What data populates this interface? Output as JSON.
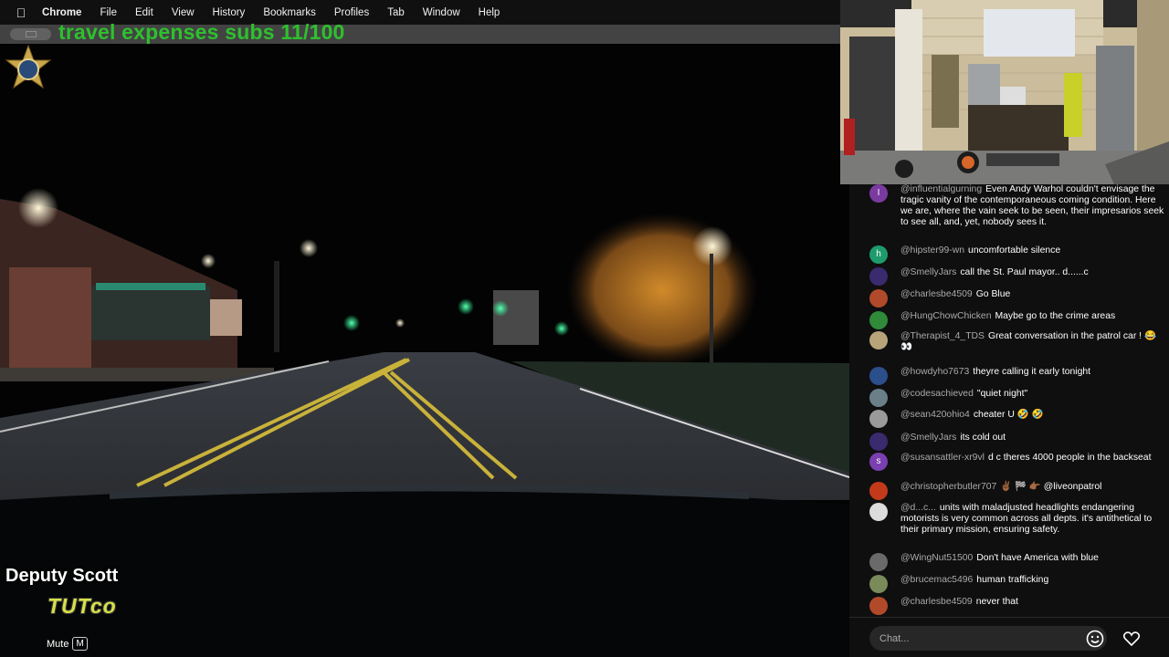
{
  "menubar": {
    "apple_icon": "apple-icon",
    "items": [
      "Chrome",
      "File",
      "Edit",
      "View",
      "History",
      "Bookmarks",
      "Profiles",
      "Tab",
      "Window",
      "Help"
    ]
  },
  "banner": {
    "text": "travel expenses subs 11/100",
    "color": "#2ec02e"
  },
  "video": {
    "deputy_label": "Deputy Scott",
    "brand_text": "TUTco",
    "mute_label": "Mute",
    "mute_key": "M"
  },
  "chat": {
    "messages": [
      {
        "user": "@influentialgurning",
        "text": "Even Andy Warhol couldn't envisage the tragic vanity of the contemporaneous coming condition. Here we are, where the vain seek to be seen, their impresarios seek to see all, and, yet, nobody sees it.",
        "avatar": "I",
        "avatar_color": "#7b3aa0"
      },
      {
        "user": "@hipster99-wn",
        "text": "uncomfortable silence",
        "avatar": "h",
        "avatar_color": "#1e9b6c"
      },
      {
        "user": "@SmellyJars",
        "text": "call the St. Paul mayor.. d......c",
        "avatar": "",
        "avatar_color": "#3a2a6e"
      },
      {
        "user": "@charlesbe4509",
        "text": "Go Blue",
        "avatar": "",
        "avatar_color": "#b04a2a"
      },
      {
        "user": "@HungChowChicken",
        "text": "Maybe go to the crime areas",
        "avatar": "",
        "avatar_color": "#2f8a3a"
      },
      {
        "user": "@Therapist_4_TDS",
        "text": "Great conversation in the patrol car ! 😂 👀",
        "avatar": "",
        "avatar_color": "#b9a37a"
      },
      {
        "user": "@howdyho7673",
        "text": "theyre calling it early tonight",
        "avatar": "",
        "avatar_color": "#2b4f8a"
      },
      {
        "user": "@codesachieved",
        "text": "\"quiet night\"",
        "avatar": "",
        "avatar_color": "#6a7f88"
      },
      {
        "user": "@sean420ohio4",
        "text": "cheater U 🤣 🤣",
        "avatar": "",
        "avatar_color": "#9a9a9a"
      },
      {
        "user": "@SmellyJars",
        "text": "its cold out",
        "avatar": "",
        "avatar_color": "#3a2a6e"
      },
      {
        "user": "@susansattler-xr9vl",
        "text": "d c theres 4000 people in the backseat",
        "avatar": "s",
        "avatar_color": "#7a3fb0"
      },
      {
        "user": "@christopherbutler707",
        "text": "✌🏾 🏁 👉🏾 @liveonpatrol",
        "avatar": "",
        "avatar_color": "#c23a1a"
      },
      {
        "user": "@d...c...",
        "text": "units with maladjusted headlights endangering motorists is very common across all depts. it's antithetical to their primary mission, ensuring safety.",
        "avatar": "",
        "avatar_color": "#dcdcdc"
      },
      {
        "user": "@WingNut51500",
        "text": "Don't have America with blue",
        "avatar": "",
        "avatar_color": "#6a6a6a"
      },
      {
        "user": "@brucemac5496",
        "text": "human trafficking",
        "avatar": "",
        "avatar_color": "#7a8a5a"
      },
      {
        "user": "@charlesbe4509",
        "text": "never that",
        "avatar": "",
        "avatar_color": "#b04a2a"
      }
    ],
    "input_placeholder": "Chat..."
  }
}
